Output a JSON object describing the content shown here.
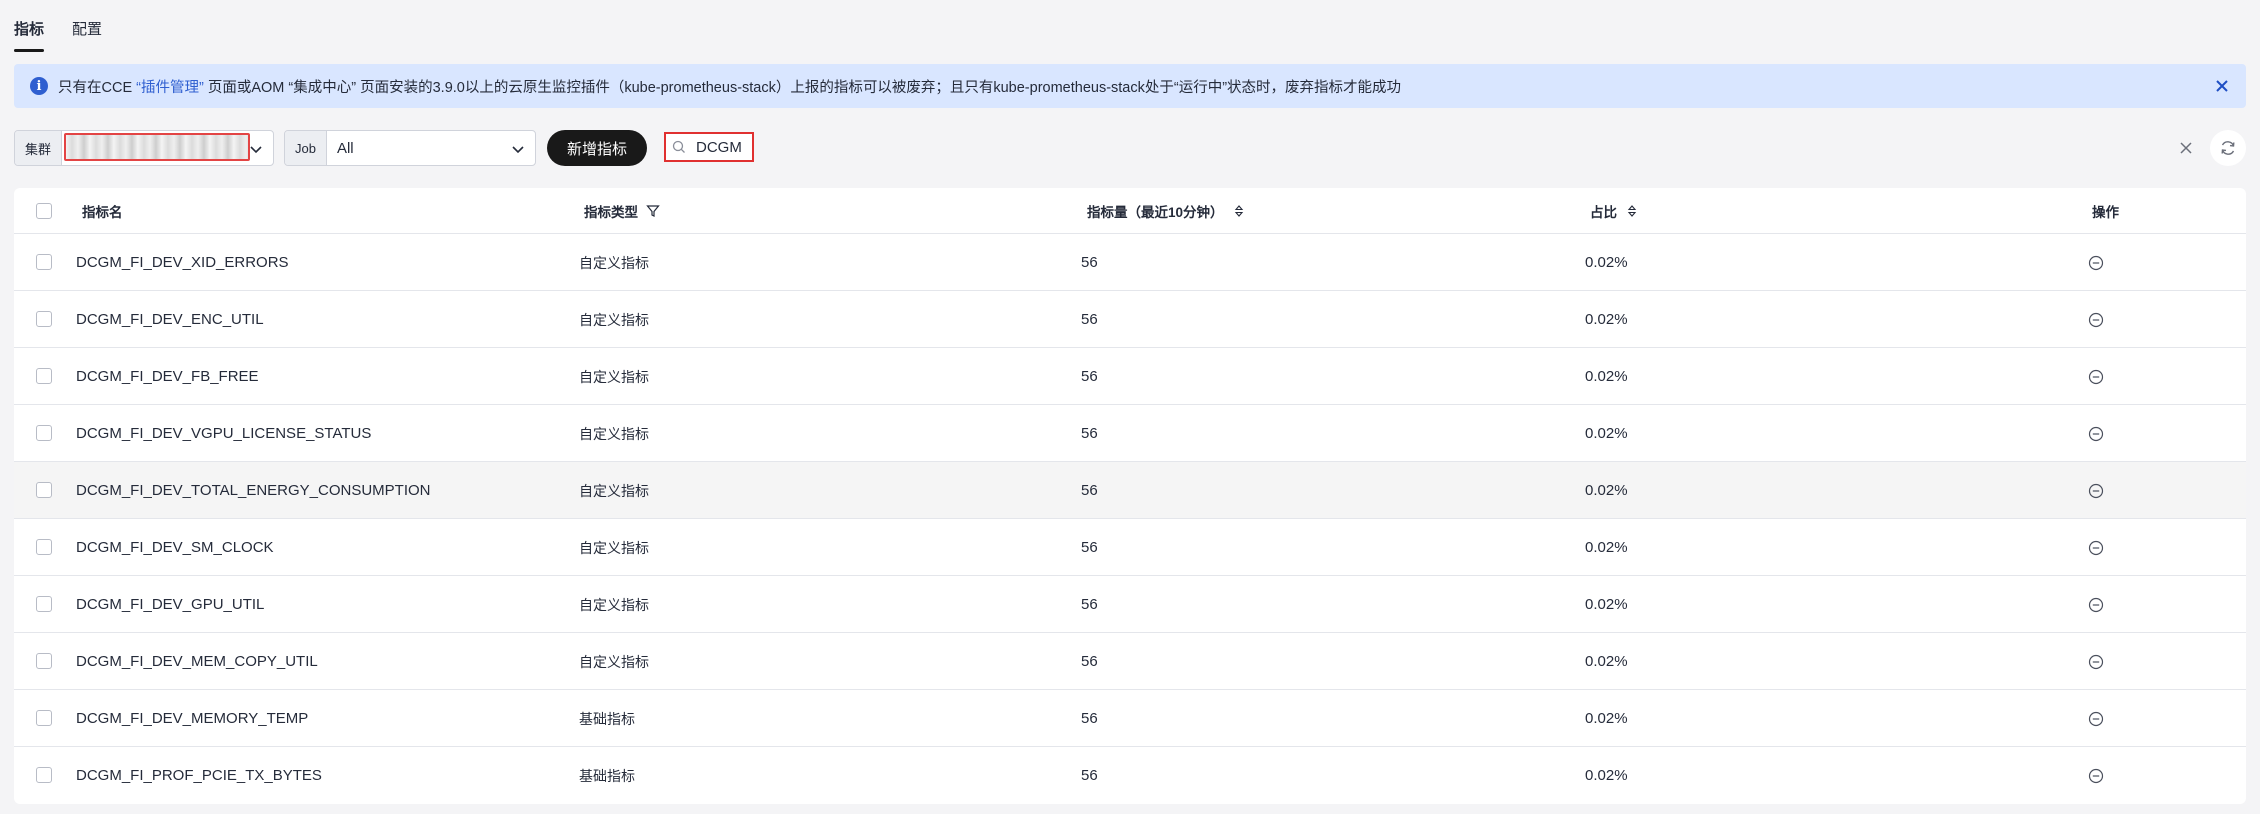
{
  "tabs": [
    {
      "label": "指标",
      "active": true
    },
    {
      "label": "配置",
      "active": false
    }
  ],
  "alert": {
    "icon": "info-icon",
    "text_before": "只有在CCE ",
    "link1": "“插件管理”",
    "text_middle1": " 页面或AOM “集成中心” 页面安装的3.9.0以上的云原生监控插件（kube-prometheus-stack）上报的指标可以被废弃；且只有kube-prometheus-stack处于“运行中”状态时，废弃指标才能成功"
  },
  "toolbar": {
    "cluster_prefix": "集群",
    "job_prefix": "Job",
    "job_value": "All",
    "add_button": "新增指标",
    "search_value": "DCGM"
  },
  "table": {
    "headers": {
      "name": "指标名",
      "type": "指标类型",
      "volume": "指标量（最近10分钟）",
      "ratio": "占比",
      "action": "操作"
    },
    "rows": [
      {
        "name": "DCGM_FI_DEV_XID_ERRORS",
        "type": "自定义指标",
        "volume": "56",
        "ratio": "0.02%"
      },
      {
        "name": "DCGM_FI_DEV_ENC_UTIL",
        "type": "自定义指标",
        "volume": "56",
        "ratio": "0.02%"
      },
      {
        "name": "DCGM_FI_DEV_FB_FREE",
        "type": "自定义指标",
        "volume": "56",
        "ratio": "0.02%"
      },
      {
        "name": "DCGM_FI_DEV_VGPU_LICENSE_STATUS",
        "type": "自定义指标",
        "volume": "56",
        "ratio": "0.02%"
      },
      {
        "name": "DCGM_FI_DEV_TOTAL_ENERGY_CONSUMPTION",
        "type": "自定义指标",
        "volume": "56",
        "ratio": "0.02%"
      },
      {
        "name": "DCGM_FI_DEV_SM_CLOCK",
        "type": "自定义指标",
        "volume": "56",
        "ratio": "0.02%"
      },
      {
        "name": "DCGM_FI_DEV_GPU_UTIL",
        "type": "自定义指标",
        "volume": "56",
        "ratio": "0.02%"
      },
      {
        "name": "DCGM_FI_DEV_MEM_COPY_UTIL",
        "type": "自定义指标",
        "volume": "56",
        "ratio": "0.02%"
      },
      {
        "name": "DCGM_FI_DEV_MEMORY_TEMP",
        "type": "基础指标",
        "volume": "56",
        "ratio": "0.02%"
      },
      {
        "name": "DCGM_FI_PROF_PCIE_TX_BYTES",
        "type": "基础指标",
        "volume": "56",
        "ratio": "0.02%"
      }
    ]
  }
}
